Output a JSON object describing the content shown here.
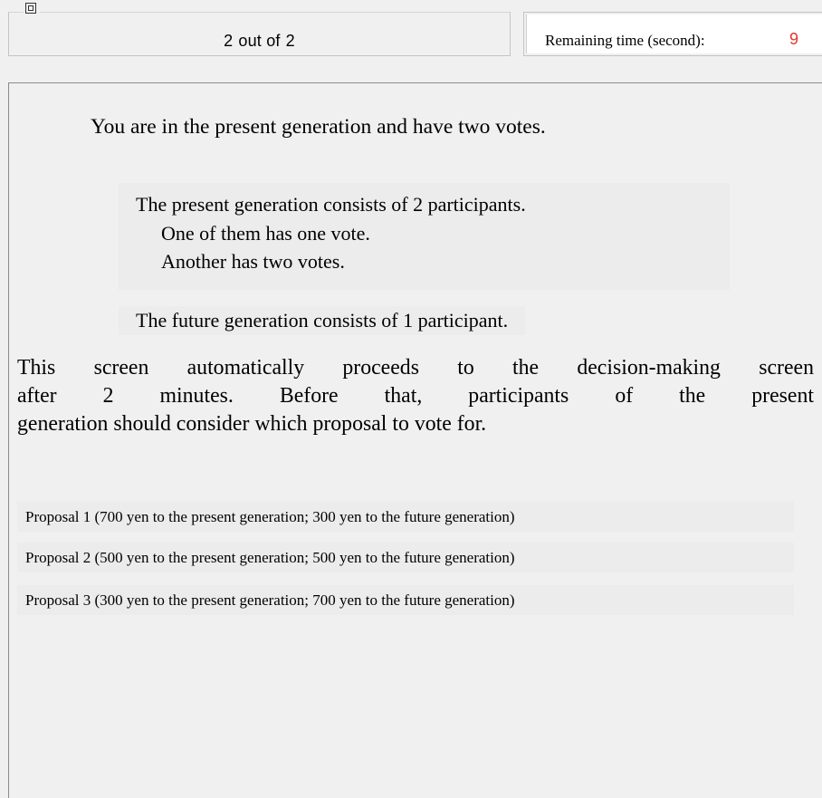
{
  "header": {
    "period_current": "2",
    "period_separator": "out of",
    "period_total": "2",
    "timer_label": "Remaining time (second):",
    "timer_value": "9",
    "corner_icon": "window-restore-icon"
  },
  "main": {
    "status": "You are in the present generation and have two votes.",
    "present_generation": {
      "summary": "The present generation consists of 2 participants.",
      "detail_1": "One of them has one vote.",
      "detail_2": "Another has two votes."
    },
    "future_generation": "The future generation consists of 1 participant.",
    "notice_lines": [
      "This screen automatically proceeds to the decision-making screen",
      "after 2 minutes. Before that, participants of the present",
      "generation should consider which proposal to vote for."
    ],
    "proposals": [
      "Proposal 1 (700 yen to the present generation; 300 yen to the future generation)",
      "Proposal 2 (500 yen to the present generation; 500 yen to the future generation)",
      "Proposal 3 (300 yen to the present generation; 700 yen to the future generation)"
    ]
  },
  "colors": {
    "background": "#f0f0f0",
    "timer_value": "#e4342f"
  }
}
